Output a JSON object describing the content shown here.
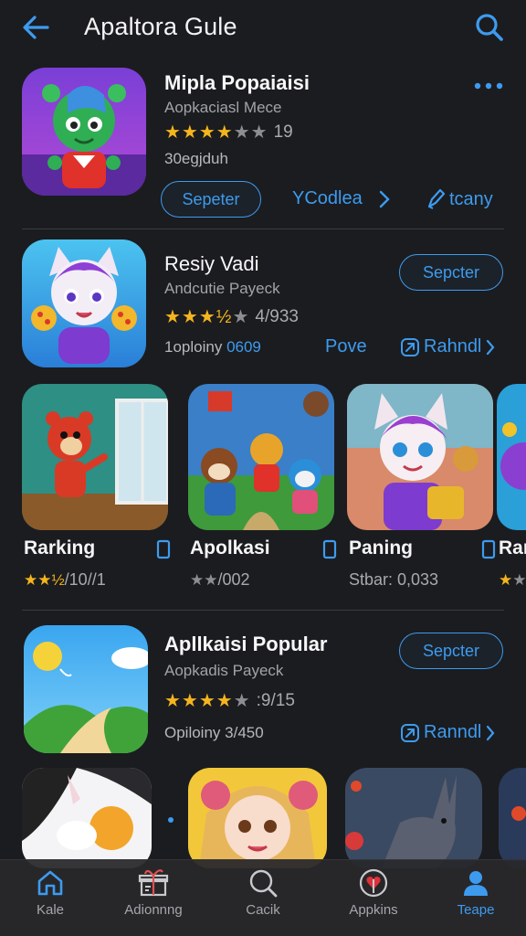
{
  "header": {
    "title": "Apaltora Gule",
    "back_icon": "arrow-left-icon",
    "search_icon": "search-icon"
  },
  "colors": {
    "accent": "#3d9bef",
    "background": "#1b1c1f",
    "star": "#f4b51e"
  },
  "featured": [
    {
      "name": "Mipla Popaiaisi",
      "subtitle": "Aopkaciasl Mece",
      "rating_value": 4,
      "rating_text": "19",
      "meta": "30egjduh",
      "button": "Sepeter",
      "link1": "YCodlea",
      "link2": "tcany"
    },
    {
      "name": "Resiy Vadi",
      "subtitle": "Andcutie Payeck",
      "rating_value": 3.5,
      "rating_text": "4/933",
      "meta_prefix": "1oploiny",
      "meta_value": "0609",
      "button": "Sepcter",
      "link1": "Pove",
      "link2": "Rahndl"
    }
  ],
  "carousel": [
    {
      "title": "Rarking",
      "rating_value": 2.5,
      "rating_text": "/10//1"
    },
    {
      "title": "Apolkasi",
      "rating_value": 2.5,
      "rating_text": "/002"
    },
    {
      "title": "Paning",
      "rating_value": 0,
      "rating_text": "Stbar: 0,033"
    },
    {
      "title": "Rar",
      "rating_value": 1.5,
      "rating_text": ""
    }
  ],
  "popular": {
    "name": "Apllkaisi Popular",
    "subtitle": "Aopkadis Payeck",
    "rating_value": 4,
    "rating_text": ":9/15",
    "meta": "Opiloiny 3/450",
    "button": "Sepcter",
    "link": "Ranndl"
  },
  "tabs": [
    {
      "label": "Kale",
      "icon": "home-icon",
      "active": false
    },
    {
      "label": "Adionnng",
      "icon": "gift-icon",
      "active": false
    },
    {
      "label": "Cacik",
      "icon": "search-icon",
      "active": false
    },
    {
      "label": "Appkins",
      "icon": "heart-badge-icon",
      "active": false
    },
    {
      "label": "Teape",
      "icon": "person-icon",
      "active": true
    }
  ]
}
